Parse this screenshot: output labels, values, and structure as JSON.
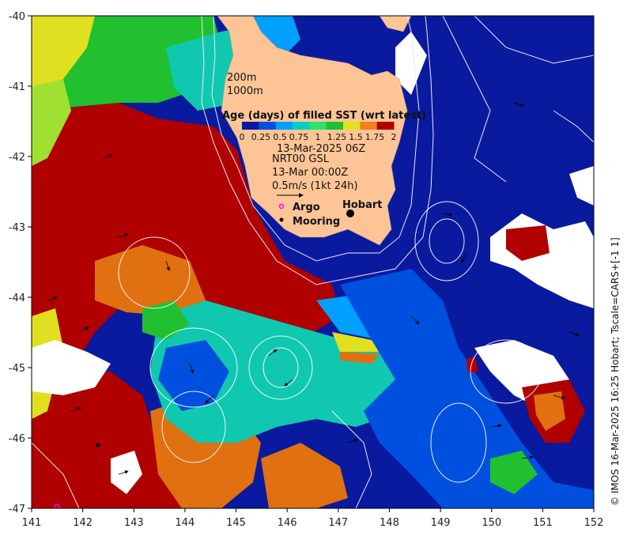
{
  "map": {
    "x_ticks": [
      "141",
      "142",
      "143",
      "144",
      "145",
      "146",
      "147",
      "148",
      "149",
      "150",
      "151",
      "152"
    ],
    "y_ticks": [
      "-40",
      "-41",
      "-42",
      "-43",
      "-44",
      "-45",
      "-46",
      "-47"
    ],
    "lon_range": [
      141,
      152
    ],
    "lat_range": [
      -47,
      -40
    ],
    "places": {
      "hobart": "Hobart"
    }
  },
  "legend": {
    "depth_200": "200m",
    "depth_1000": "1000m",
    "colorbar_title": "Age (days) of filled SST (wrt latest)",
    "colorbar_ticks": [
      "0",
      "0.25",
      "0.5",
      "0.75",
      "1",
      "1.25",
      "1.5",
      "1.75",
      "2"
    ],
    "colorbar_colors": [
      "#0a1a9e",
      "#0050e0",
      "#00a0ff",
      "#00d0c8",
      "#30e070",
      "#20c030",
      "#e0e020",
      "#f08020",
      "#b00000"
    ],
    "sst_date": "13-Mar-2025 06Z",
    "gsl_label": "NRT00 GSL",
    "gsl_date": "13-Mar 00:00Z",
    "scale_label": "0.5m/s (1kt 24h)",
    "argo_label": "Argo",
    "mooring_label": "Mooring"
  },
  "credit": "© IMOS 16-Mar-2025 16:25 Hobart; Tscale=CARS+[-1 1]",
  "colors": {
    "land": "#fdc596",
    "deep_blue": "#0a1a9e",
    "red": "#b00000",
    "orange": "#e07010",
    "teal": "#10c8b0",
    "green": "#20c030",
    "blue": "#0050e0",
    "argo": "#ff00ff"
  }
}
